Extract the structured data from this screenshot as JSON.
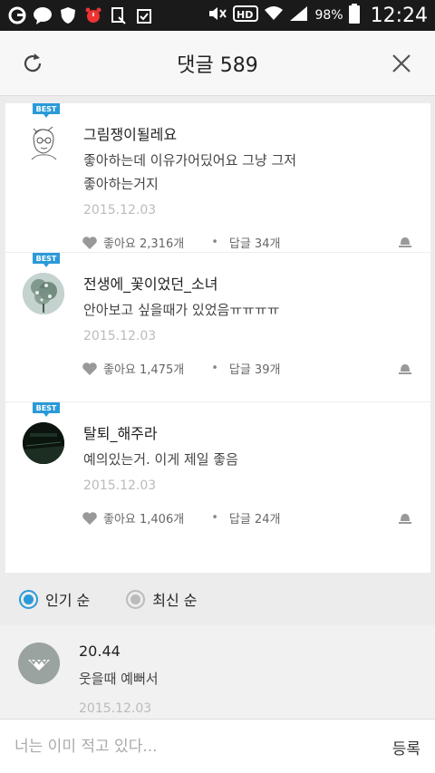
{
  "status_bar": {
    "battery_percent": "98%",
    "time": "12:24",
    "icons": [
      "g-icon",
      "talk-icon",
      "shield-icon",
      "alarm-icon",
      "download-icon",
      "clipboard-icon",
      "mute-icon",
      "hd-icon",
      "wifi-icon",
      "signal-icon",
      "battery-icon"
    ]
  },
  "header": {
    "title": "댓글 589"
  },
  "best_comments": [
    {
      "badge": "BEST",
      "nickname": "그림쟁이될레요",
      "text": "좋아하는데 이유가어딨어요 그냥 그저\n좋아하는거지",
      "date": "2015.12.03",
      "likes": "좋아요 2,316개",
      "replies": "답글 34개"
    },
    {
      "badge": "BEST",
      "nickname": "전생에_꽃이었던_소녀",
      "text": "안아보고 싶을때가 있었음ㅠㅠㅠㅠ",
      "date": "2015.12.03",
      "likes": "좋아요 1,475개",
      "replies": "답글 39개"
    },
    {
      "badge": "BEST",
      "nickname": "탈퇴_해주라",
      "text": "예의있는거. 이게 제일 좋음",
      "date": "2015.12.03",
      "likes": "좋아요 1,406개",
      "replies": "답글 24개"
    }
  ],
  "sort": {
    "popular": "인기 순",
    "latest": "최신 순",
    "selected": "popular"
  },
  "list_comments": [
    {
      "nickname": "20.44",
      "text": "웃을때 예뻐서",
      "date": "2015.12.03"
    }
  ],
  "input": {
    "placeholder": "너는 이미 적고 있다...",
    "submit": "등록"
  },
  "colors": {
    "accent": "#2a9ad8",
    "background": "#ececec"
  }
}
